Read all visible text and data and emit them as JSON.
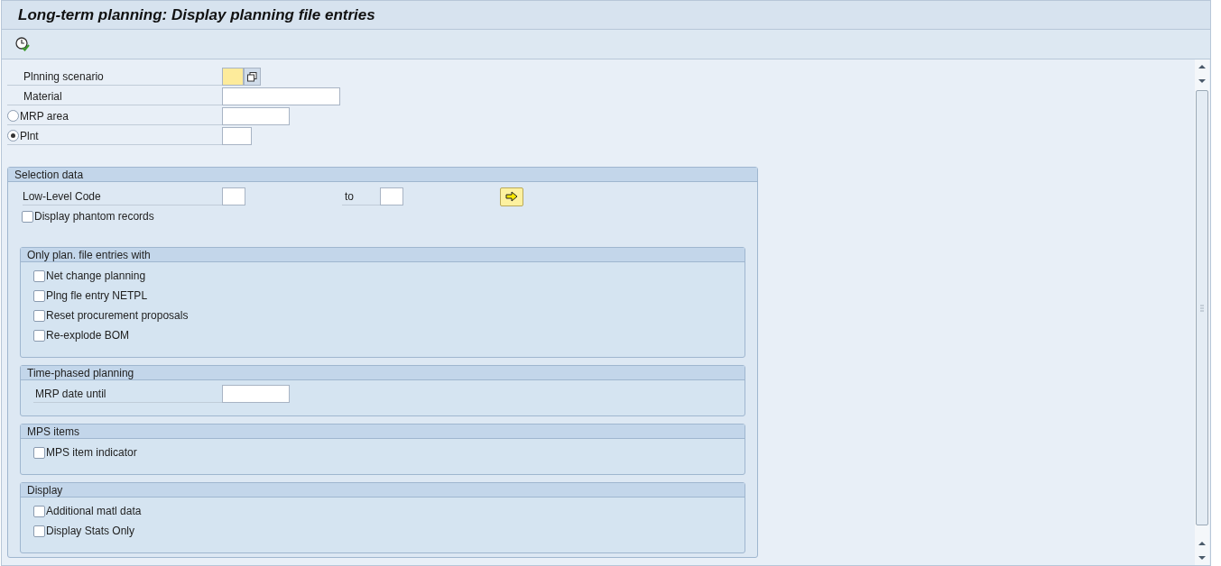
{
  "window": {
    "title": "Long-term planning: Display planning file entries"
  },
  "fields": [
    {
      "kind": "field",
      "label": "Plnning scenario",
      "focused": true,
      "value_help": true
    },
    {
      "kind": "field",
      "label": "Material",
      "focused": false
    },
    {
      "kind": "radio",
      "label": "MRP area",
      "selected": false
    },
    {
      "kind": "radio",
      "label": "Plnt",
      "selected": true
    }
  ],
  "selection": {
    "title": "Selection data",
    "range_label": "Low-Level Code",
    "to_label": "to",
    "phantom": {
      "label": "Display phantom records",
      "checked": false
    },
    "groups": [
      {
        "title": "Only plan. file entries with",
        "items": [
          {
            "kind": "checkbox",
            "label": "Net change planning",
            "checked": false
          },
          {
            "kind": "checkbox",
            "label": "Plng fle entry NETPL",
            "checked": false
          },
          {
            "kind": "checkbox",
            "label": "Reset procurement proposals",
            "checked": false
          },
          {
            "kind": "checkbox",
            "label": "Re-explode BOM",
            "checked": false
          }
        ]
      },
      {
        "title": "Time-phased planning",
        "items": [
          {
            "kind": "field",
            "label": "MRP date until"
          }
        ]
      },
      {
        "title": "MPS items",
        "items": [
          {
            "kind": "checkbox",
            "label": "MPS item indicator",
            "checked": false
          }
        ]
      },
      {
        "title": "Display",
        "items": [
          {
            "kind": "checkbox",
            "label": "Additional matl data",
            "checked": false
          },
          {
            "kind": "checkbox",
            "label": "Display Stats Only",
            "checked": false
          }
        ]
      }
    ]
  }
}
